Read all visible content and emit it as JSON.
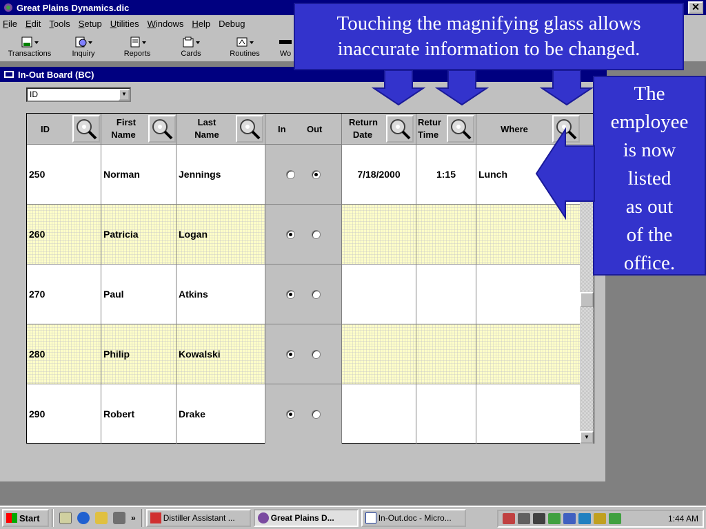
{
  "window": {
    "title": "Great Plains Dynamics.dic",
    "close_glyph": "✕"
  },
  "menu": [
    {
      "label": "File",
      "u": "F",
      "rest": "ile"
    },
    {
      "label": "Edit",
      "u": "E",
      "rest": "dit"
    },
    {
      "label": "Tools",
      "u": "T",
      "rest": "ools"
    },
    {
      "label": "Setup",
      "u": "S",
      "rest": "etup"
    },
    {
      "label": "Utilities",
      "u": "U",
      "rest": "tilities"
    },
    {
      "label": "Windows",
      "u": "W",
      "rest": "indows"
    },
    {
      "label": "Help",
      "u": "H",
      "rest": "elp"
    },
    {
      "label": "Debug",
      "u": "",
      "rest": "Debug"
    }
  ],
  "toolbar": {
    "transactions": "Transactions",
    "inquiry": "Inquiry",
    "reports": "Reports",
    "cards": "Cards",
    "routines": "Routines",
    "wo": "Wo"
  },
  "child_window": {
    "title": "In-Out Board (BC)"
  },
  "sort": {
    "selected": "ID"
  },
  "grid": {
    "headers": {
      "id": "ID",
      "first_name_1": "First",
      "first_name_2": "Name",
      "last_name_1": "Last",
      "last_name_2": "Name",
      "in": "In",
      "out": "Out",
      "return_date_1": "Return",
      "return_date_2": "Date",
      "return_time_1": "Retur",
      "return_time_2": "Time",
      "where": "Where"
    },
    "rows": [
      {
        "id": "250",
        "first": "Norman",
        "last": "Jennings",
        "status": "out",
        "return_date": "7/18/2000",
        "return_time": "1:15",
        "where": "Lunch"
      },
      {
        "id": "260",
        "first": "Patricia",
        "last": "Logan",
        "status": "in",
        "return_date": "",
        "return_time": "",
        "where": ""
      },
      {
        "id": "270",
        "first": "Paul",
        "last": "Atkins",
        "status": "in",
        "return_date": "",
        "return_time": "",
        "where": ""
      },
      {
        "id": "280",
        "first": "Philip",
        "last": "Kowalski",
        "status": "in",
        "return_date": "",
        "return_time": "",
        "where": ""
      },
      {
        "id": "290",
        "first": "Robert",
        "last": "Drake",
        "status": "in",
        "return_date": "",
        "return_time": "",
        "where": ""
      }
    ]
  },
  "callouts": {
    "top_line1": "Touching the magnifying glass allows",
    "top_line2": "inaccurate information to be changed.",
    "right_lines": [
      "The",
      "employee",
      "is now",
      "listed",
      "as out",
      "of the",
      "office."
    ]
  },
  "taskbar": {
    "start": "Start",
    "chevron": "»",
    "tasks": [
      "Distiller Assistant ...",
      "Great Plains D...",
      "In-Out.doc - Micro..."
    ],
    "clock": "1:44 AM"
  },
  "colors": {
    "title_bar": "#000080",
    "callout_bg": "#3333cc",
    "row_alt": "#ffffc8",
    "face": "#c0c0c0"
  }
}
